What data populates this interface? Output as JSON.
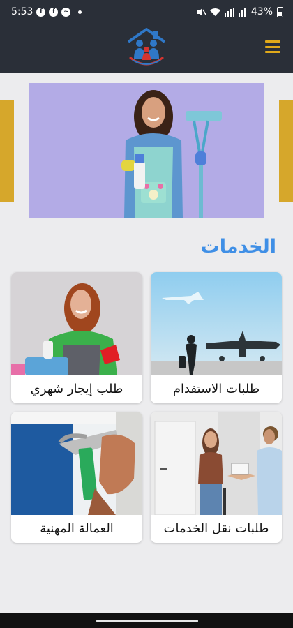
{
  "status_bar": {
    "time": "5:53",
    "notif_icons": [
      "facebook-icon",
      "facebook-icon",
      "messenger-icon"
    ],
    "battery": "43%"
  },
  "header": {
    "logo": "home-family-logo",
    "menu_icon": "hamburger-menu-icon",
    "accent": "#e0a91a",
    "background": "#2a2f38"
  },
  "section": {
    "title": "الخدمات",
    "color": "#3f8fe6"
  },
  "services": [
    {
      "label": "طلبات الاستقدام"
    },
    {
      "label": "طلب إيجار شهري"
    },
    {
      "label": "طلبات نقل الخدمات"
    },
    {
      "label": "العمالة المهنية"
    }
  ]
}
